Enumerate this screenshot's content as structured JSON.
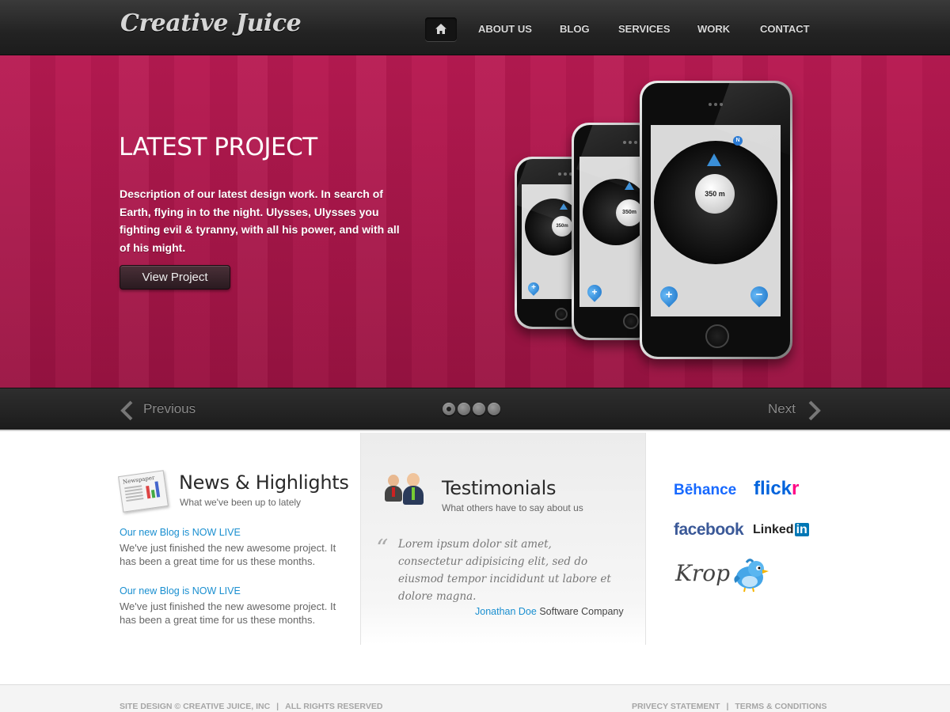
{
  "header": {
    "logo": "Creative Juice",
    "nav": [
      "ABOUT US",
      "BLOG",
      "SERVICES",
      "WORK",
      "CONTACT"
    ]
  },
  "hero": {
    "title": "LATEST PROJECT",
    "description": "Description of our latest design work. In search of Earth, flying in to the night. Ulysses, Ulysses you fighting evil & tyranny, with all his power, and with all of his might.",
    "button": "View Project",
    "phone_distance": "350 m",
    "phone_distance_compact": "350m",
    "north": "N",
    "background_color": "#b01a4f"
  },
  "slider": {
    "previous": "Previous",
    "next": "Next",
    "slide_count": 4,
    "active_slide": 1
  },
  "news": {
    "title": "News & Highlights",
    "subtitle": "What we've been up to lately",
    "icon_label": "Newspaper",
    "items": [
      {
        "link": "Our new Blog is NOW LIVE",
        "text": "We've just finished the new awesome project. It has been a great time for us these months."
      },
      {
        "link": "Our new Blog is NOW LIVE",
        "text": "We've just finished the new awesome project. It has been a great time for us these months."
      }
    ]
  },
  "testimonials": {
    "title": "Testimonials",
    "subtitle": "What others have to say about us",
    "quote": "Lorem ipsum dolor sit amet, consectetur adipisicing elit, sed do eiusmod tempor incididunt ut labore et dolore magna.",
    "author_name": "Jonathan Doe",
    "author_company": "Software Company"
  },
  "social": {
    "behance": "Bēhance",
    "flickr_1": "flick",
    "flickr_2": "r",
    "facebook": "facebook",
    "linkedin_1": "Linked",
    "linkedin_2": "in",
    "krop": "Krop"
  },
  "footer": {
    "credit": "SITE DESIGN © CREATIVE JUICE, INC",
    "rights": "ALL RIGHTS RESERVED",
    "privacy": "PRIVECY STATEMENT",
    "terms": "TERMS & CONDITIONS",
    "separator": "|"
  },
  "colors": {
    "accent_link": "#1a8fd0",
    "hero": "#b01a4f",
    "header": "#2a2a2a"
  }
}
